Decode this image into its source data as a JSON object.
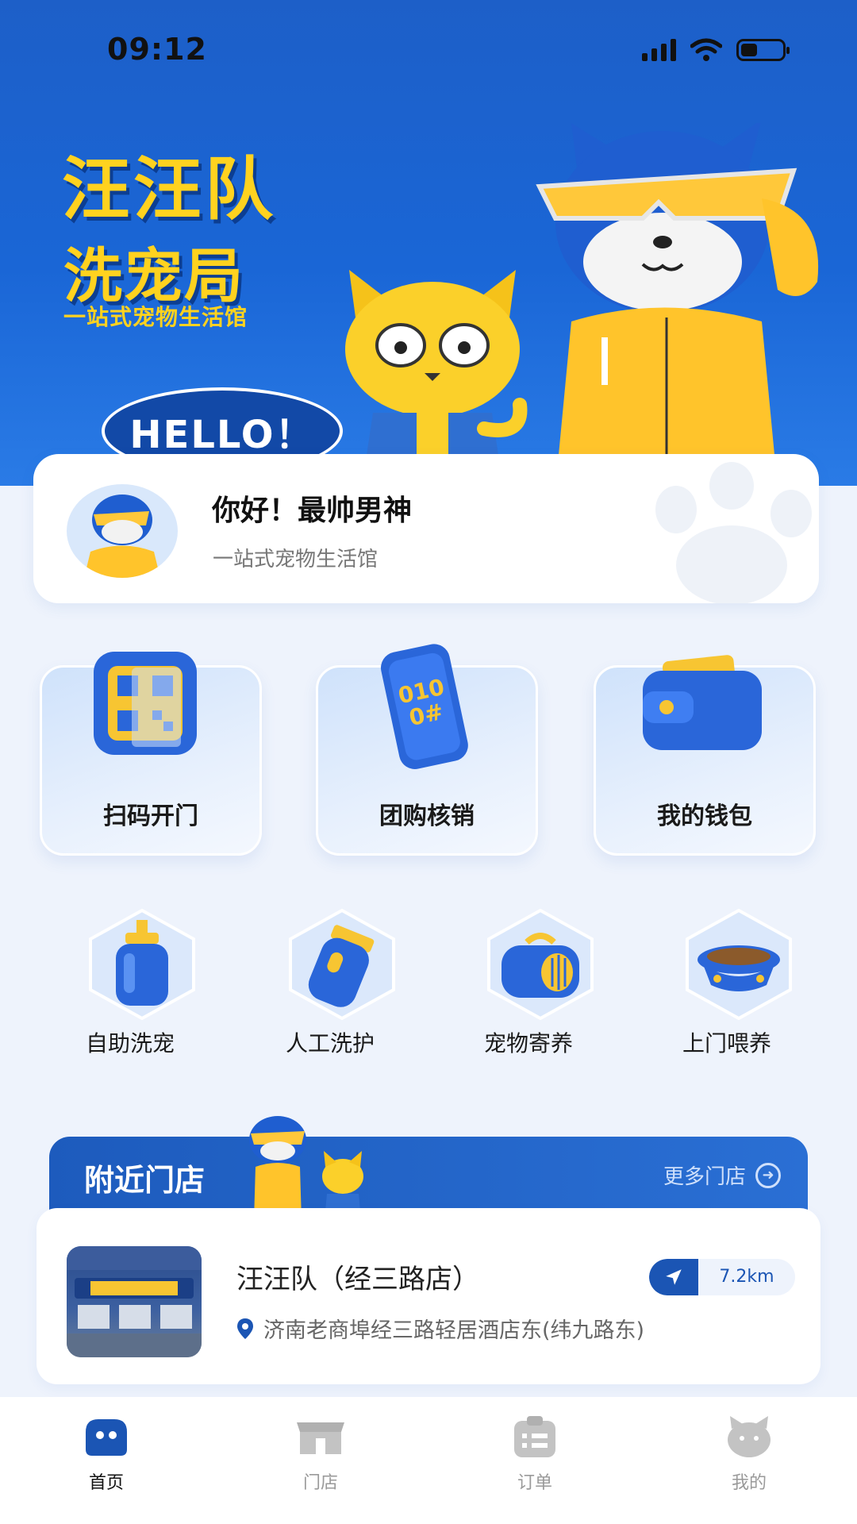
{
  "status_bar": {
    "time": "09:12"
  },
  "banner": {
    "brand_title": "汪汪队",
    "brand_subtitle": "洗宠局",
    "tagline": "一站式宠物生活馆",
    "hello": "HELLO！"
  },
  "greeting": {
    "name": "你好！最帅男神",
    "description": "一站式宠物生活馆"
  },
  "features": [
    {
      "label": "扫码开门",
      "icon": "qr-scan-icon"
    },
    {
      "label": "团购核销",
      "icon": "phone-qr-icon"
    },
    {
      "label": "我的钱包",
      "icon": "wallet-icon"
    }
  ],
  "services": [
    {
      "label": "自助洗宠",
      "icon": "shampoo-bottle-icon"
    },
    {
      "label": "人工洗护",
      "icon": "clipper-icon"
    },
    {
      "label": "宠物寄养",
      "icon": "pet-carrier-icon"
    },
    {
      "label": "上门喂养",
      "icon": "food-bowl-icon"
    }
  ],
  "nearby": {
    "title": "附近门店",
    "more_label": "更多门店",
    "store": {
      "name": "汪汪队（经三路店）",
      "distance": "7.2km",
      "address": "济南老商埠经三路轻居酒店东(纬九路东)"
    }
  },
  "tabbar": {
    "items": [
      {
        "label": "首页",
        "icon": "home-icon",
        "active": true
      },
      {
        "label": "门店",
        "icon": "store-icon",
        "active": false
      },
      {
        "label": "订单",
        "icon": "order-icon",
        "active": false
      },
      {
        "label": "我的",
        "icon": "profile-icon",
        "active": false
      }
    ]
  },
  "colors": {
    "brand_blue": "#1d5fc8",
    "brand_yellow": "#ffd21f",
    "background": "#eef3fc"
  }
}
